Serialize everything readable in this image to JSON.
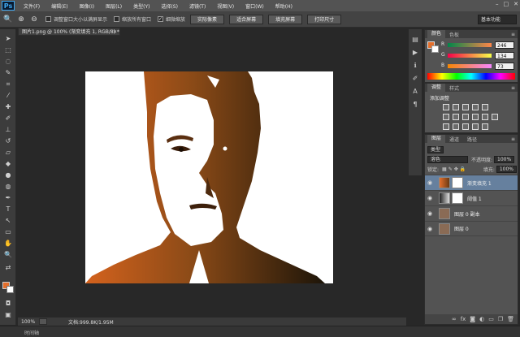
{
  "app": {
    "logo": "Ps",
    "menu": [
      "文件(F)",
      "编辑(E)",
      "图像(I)",
      "图层(L)",
      "类型(Y)",
      "选择(S)",
      "滤镜(T)",
      "视图(V)",
      "窗口(W)",
      "帮助(H)"
    ],
    "window_controls": [
      "–",
      "□",
      "✕"
    ]
  },
  "options": {
    "check_resize": "调整窗口大小以满屏显示",
    "check_all_windows": "缩放所有窗口",
    "check_scrubby": "细微缩放",
    "btn_actual": "实际像素",
    "btn_fit": "适合屏幕",
    "btn_fill": "填充屏幕",
    "btn_print": "打印尺寸",
    "workspace": "基本功能"
  },
  "document": {
    "tab_title": "图片1.png @ 100% (渐变填充 1, RGB/8) *",
    "zoom": "100%",
    "doc_info": "文档:999.8K/1.95M",
    "timeline_label": "时间轴"
  },
  "color_panel": {
    "tabs": [
      "颜色",
      "色板"
    ],
    "r_label": "R",
    "g_label": "G",
    "b_label": "B",
    "r": "246",
    "g": "134",
    "b": "73",
    "fg_color": "#e46f2c"
  },
  "adjustments_panel": {
    "tabs": [
      "调整",
      "样式"
    ],
    "title": "添加调整"
  },
  "layers_panel": {
    "tabs": [
      "图层",
      "通道",
      "路径"
    ],
    "filter_kind": "类型",
    "blend_mode": "溶色",
    "opacity_label": "不透明度:",
    "opacity": "100%",
    "lock_label": "锁定:",
    "fill_label": "填充:",
    "fill": "100%",
    "layers": [
      {
        "name": "渐变填充 1",
        "selected": true
      },
      {
        "name": "阈值 1",
        "selected": false
      },
      {
        "name": "图层 0 副本",
        "selected": false
      },
      {
        "name": "图层 0",
        "selected": false
      }
    ]
  }
}
